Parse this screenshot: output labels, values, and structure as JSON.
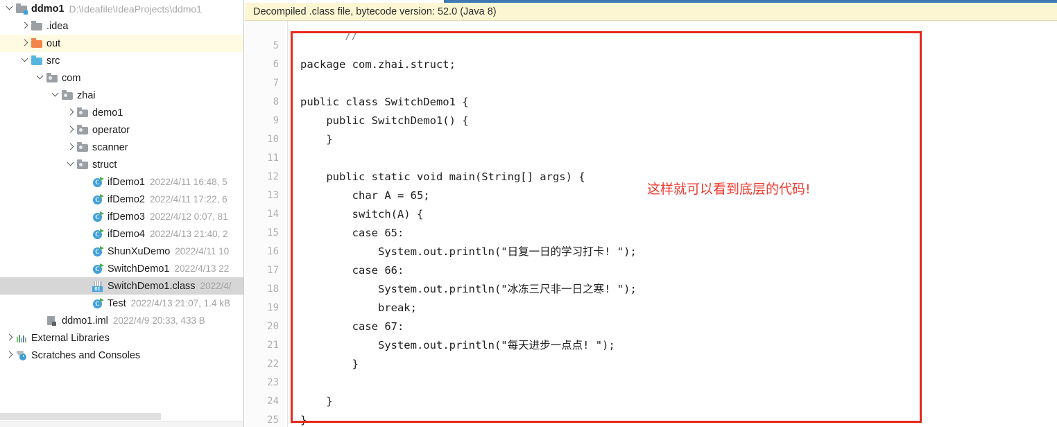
{
  "project_panel": {
    "tree": [
      {
        "indent": 0,
        "arrow": "down",
        "icon": "folder-module-blue",
        "label": "ddmo1",
        "bold": true,
        "path": "D:\\Ideafile\\IdeaProjects\\ddmo1",
        "meta": "",
        "highlight": "none"
      },
      {
        "indent": 1,
        "arrow": "right",
        "icon": "folder-gray",
        "label": ".idea",
        "bold": false,
        "path": "",
        "meta": "",
        "highlight": "none"
      },
      {
        "indent": 1,
        "arrow": "right",
        "icon": "folder-orange",
        "label": "out",
        "bold": false,
        "path": "",
        "meta": "",
        "highlight": "yellow"
      },
      {
        "indent": 1,
        "arrow": "down",
        "icon": "folder-blue",
        "label": "src",
        "bold": false,
        "path": "",
        "meta": "",
        "highlight": "none"
      },
      {
        "indent": 2,
        "arrow": "down",
        "icon": "folder-package",
        "label": "com",
        "bold": false,
        "path": "",
        "meta": "",
        "highlight": "none"
      },
      {
        "indent": 3,
        "arrow": "down",
        "icon": "folder-package",
        "label": "zhai",
        "bold": false,
        "path": "",
        "meta": "",
        "highlight": "none"
      },
      {
        "indent": 4,
        "arrow": "right",
        "icon": "folder-package",
        "label": "demo1",
        "bold": false,
        "path": "",
        "meta": "",
        "highlight": "none"
      },
      {
        "indent": 4,
        "arrow": "right",
        "icon": "folder-package",
        "label": "operator",
        "bold": false,
        "path": "",
        "meta": "",
        "highlight": "none"
      },
      {
        "indent": 4,
        "arrow": "right",
        "icon": "folder-package",
        "label": "scanner",
        "bold": false,
        "path": "",
        "meta": "",
        "highlight": "none"
      },
      {
        "indent": 4,
        "arrow": "down",
        "icon": "folder-package",
        "label": "struct",
        "bold": false,
        "path": "",
        "meta": "",
        "highlight": "none"
      },
      {
        "indent": 5,
        "arrow": "none",
        "icon": "java-class",
        "label": "ifDemo1",
        "bold": false,
        "path": "",
        "meta": "2022/4/11 16:48, 5",
        "highlight": "none"
      },
      {
        "indent": 5,
        "arrow": "none",
        "icon": "java-class",
        "label": "ifDemo2",
        "bold": false,
        "path": "",
        "meta": "2022/4/11 17:22, 6",
        "highlight": "none"
      },
      {
        "indent": 5,
        "arrow": "none",
        "icon": "java-class",
        "label": "ifDemo3",
        "bold": false,
        "path": "",
        "meta": "2022/4/12 0:07, 81",
        "highlight": "none"
      },
      {
        "indent": 5,
        "arrow": "none",
        "icon": "java-class",
        "label": "ifDemo4",
        "bold": false,
        "path": "",
        "meta": "2022/4/13 21:40, 2",
        "highlight": "none"
      },
      {
        "indent": 5,
        "arrow": "none",
        "icon": "java-class",
        "label": "ShunXuDemo",
        "bold": false,
        "path": "",
        "meta": "2022/4/11 10",
        "highlight": "none"
      },
      {
        "indent": 5,
        "arrow": "none",
        "icon": "java-class",
        "label": "SwitchDemo1",
        "bold": false,
        "path": "",
        "meta": "2022/4/13 22",
        "highlight": "none"
      },
      {
        "indent": 5,
        "arrow": "none",
        "icon": "compiled-class",
        "label": "SwitchDemo1.class",
        "bold": false,
        "path": "",
        "meta": "2022/4/",
        "highlight": "gray"
      },
      {
        "indent": 5,
        "arrow": "none",
        "icon": "java-class",
        "label": "Test",
        "bold": false,
        "path": "",
        "meta": "2022/4/13 21:07, 1.4 kB",
        "highlight": "none"
      },
      {
        "indent": 2,
        "arrow": "none",
        "icon": "iml-file",
        "label": "ddmo1.iml",
        "bold": false,
        "path": "",
        "meta": "2022/4/9 20:33, 433 B",
        "highlight": "none"
      },
      {
        "indent": 0,
        "arrow": "right",
        "icon": "external-libraries",
        "label": "External Libraries",
        "bold": false,
        "path": "",
        "meta": "",
        "highlight": "none"
      },
      {
        "indent": 0,
        "arrow": "right",
        "icon": "scratches",
        "label": "Scratches and Consoles",
        "bold": false,
        "path": "",
        "meta": "",
        "highlight": "none"
      }
    ]
  },
  "editor": {
    "banner_text": "Decompiled .class file, bytecode version: 52.0 (Java 8)",
    "partial_line_above": "//",
    "first_line_number": 5,
    "line_numbers": [
      5,
      6,
      7,
      8,
      9,
      10,
      11,
      12,
      13,
      14,
      15,
      16,
      17,
      18,
      19,
      20,
      21,
      22,
      23,
      24,
      25
    ],
    "code_lines": [
      "",
      "package com.zhai.struct;",
      "",
      "public class SwitchDemo1 {",
      "    public SwitchDemo1() {",
      "    }",
      "",
      "    public static void main(String[] args) {",
      "        char A = 65;",
      "        switch(A) {",
      "        case 65:",
      "            System.out.println(\"日复一日的学习打卡! \");",
      "        case 66:",
      "            System.out.println(\"冰冻三尺非一日之寒! \");",
      "            break;",
      "        case 67:",
      "            System.out.println(\"每天进步一点点! \");",
      "        }",
      "",
      "    }",
      "}"
    ]
  },
  "annotation": {
    "text": "这样就可以看到底层的代码!",
    "color": "#f03a2e",
    "box_color": "#e8271c"
  },
  "colors": {
    "banner_bg": "#fdf6d3",
    "selected_row": "#d6d6d6",
    "highlight_row": "#fffbe2",
    "gutter_bg": "#fbfbfb",
    "top_strip": "#3d7ab5"
  }
}
